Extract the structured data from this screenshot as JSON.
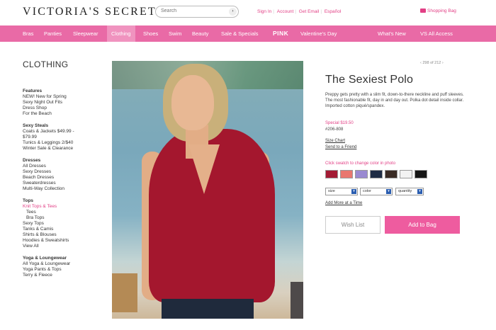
{
  "header": {
    "logo": "VICTORIA'S SECRET",
    "search_placeholder": "Search",
    "links": [
      "Sign In",
      "Account",
      "Get Email",
      "Español"
    ],
    "bag": "Shopping Bag"
  },
  "nav": {
    "items": [
      "Bras",
      "Panties",
      "Sleepwear",
      "Clothing",
      "Shoes",
      "Swim",
      "Beauty",
      "Sale & Specials",
      "PINK",
      "Valentine's Day",
      "What's New",
      "VS All Access"
    ]
  },
  "sidebar": {
    "title": "CLOTHING",
    "sections": [
      {
        "heading": "Features",
        "items": [
          "NEW! New for Spring",
          "Sexy Night Out Fits",
          "Dress Shop",
          "For the Beach"
        ]
      },
      {
        "heading": "Sexy Steals",
        "items": [
          "Coats & Jackets $49.99 -",
          "$79.99",
          "Tunics & Leggings 2/$40",
          "Winter Sale & Clearance"
        ]
      },
      {
        "heading": "Dresses",
        "items": [
          "All Dresses",
          "Sexy Dresses",
          "Beach Dresses",
          "Sweaterdresses",
          "Multi-Way Collection"
        ]
      },
      {
        "heading": "Tops",
        "items": [
          "Knit Tops & Tees",
          "Tees",
          "Bra Tops",
          "Sexy Tops",
          "Tanks & Camis",
          "Shirts & Blouses",
          "Hoodies & Sweatshirts",
          "View All"
        ]
      },
      {
        "heading": "Yoga & Loungewear",
        "items": [
          "All Yoga & Loungewear",
          "Yoga Pants & Tops",
          "Terry & Fleece"
        ]
      }
    ]
  },
  "product": {
    "pager": "‹   298 of 212   ›",
    "title": "The Sexiest Polo",
    "description": "Preppy gets pretty with a slim fit, down-to-there neckline and puff sleeves. The most fashionable fit, day in and day out. Polka dot detail inside collar. Imported cotton piqué/spandex.",
    "price": "Special $19.50",
    "sku": "#206-808",
    "size_chart": "Size Chart",
    "send_friend": "Send to a Friend",
    "swatch_hint": "Click swatch to change color in photo",
    "swatch_colors": [
      "#a31b34",
      "#e9776f",
      "#9a8ad1",
      "#1e2c44",
      "#3a2b24",
      "#f2f2f2",
      "#161616"
    ],
    "selects": {
      "size": "size",
      "color": "color",
      "quantity": "quantity"
    },
    "add_more": "Add More at a Time",
    "wish_list": "Wish List",
    "add_to_bag": "Add to Bag"
  },
  "colors": {
    "accent": "#e96aa6",
    "link": "#e23f85"
  }
}
